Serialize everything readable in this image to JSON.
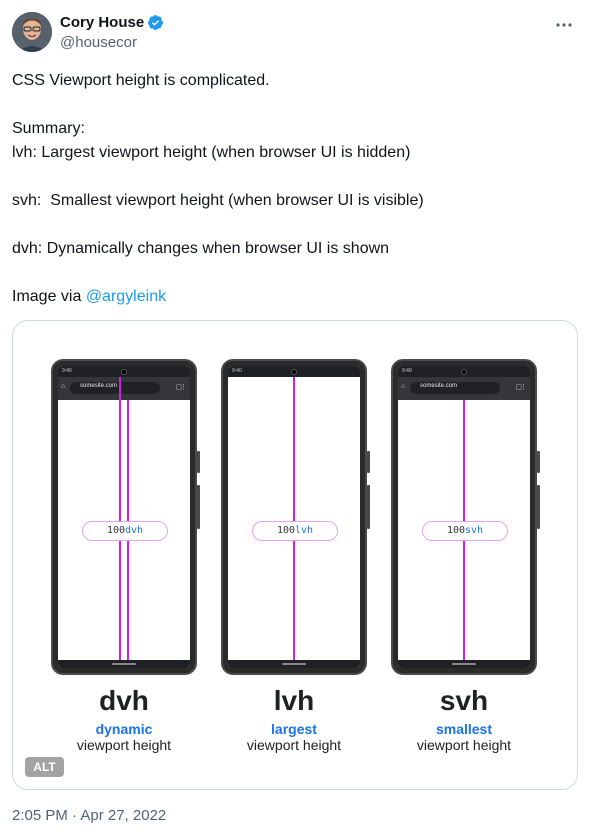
{
  "author": {
    "name": "Cory House",
    "handle": "@housecor",
    "verified_color": "#1d9bf0"
  },
  "tweet": {
    "lines": [
      "CSS Viewport height is complicated.",
      "",
      "Summary:",
      "lvh: Largest viewport height (when browser UI is hidden)",
      "",
      "svh:  Smallest viewport height (when browser UI is visible)",
      "",
      "dvh: Dynamically changes when browser UI is shown",
      ""
    ],
    "image_via_prefix": "Image via ",
    "image_via_link": "@argyleink",
    "timestamp": "2:05 PM · Apr 27, 2022"
  },
  "media": {
    "alt_badge": "ALT",
    "url_text": "somesite.com",
    "status_time": "9:40",
    "line_color": "#d01ee6",
    "accent_color": "#1a73e8",
    "phones": [
      {
        "pill_prefix": "100",
        "unit": "dvh",
        "title": "dvh",
        "word": "dynamic",
        "sub": "viewport height"
      },
      {
        "pill_prefix": "100",
        "unit": "lvh",
        "title": "lvh",
        "word": "largest",
        "sub": "viewport height"
      },
      {
        "pill_prefix": "100",
        "unit": "svh",
        "title": "svh",
        "word": "smallest",
        "sub": "viewport height"
      }
    ]
  }
}
